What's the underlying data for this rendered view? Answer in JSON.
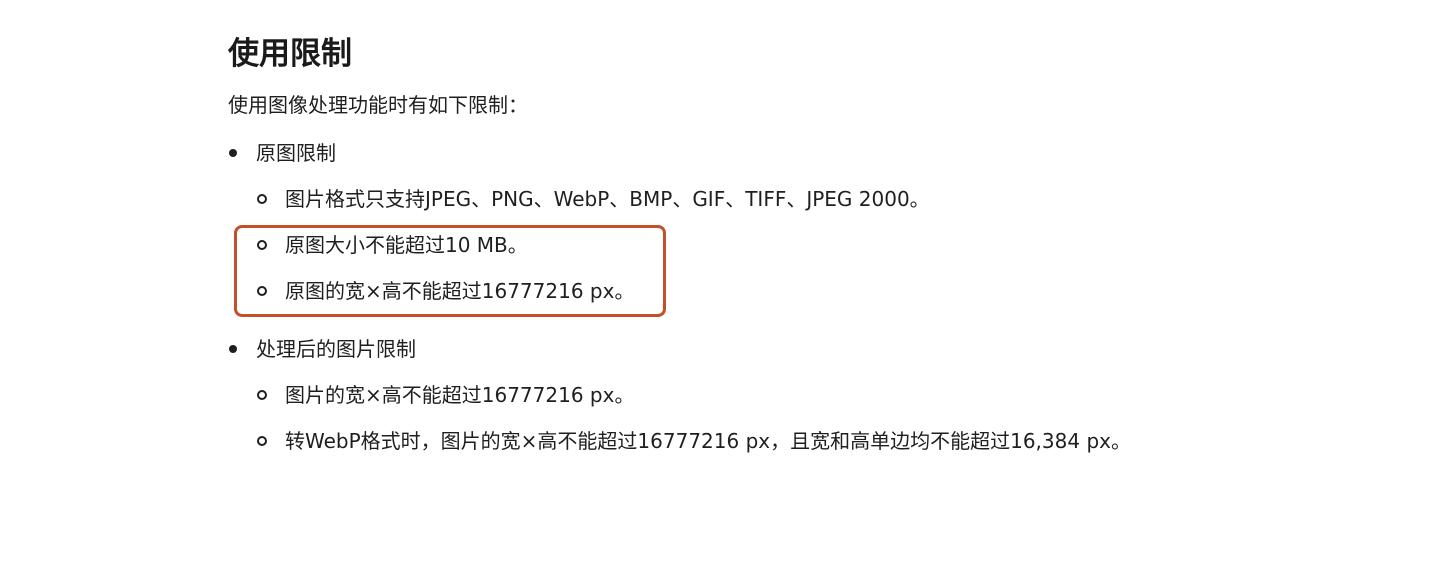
{
  "document": {
    "title": "使用限制",
    "intro": "使用图像处理功能时有如下限制：",
    "sections": [
      {
        "label": "原图限制",
        "items": [
          "图片格式只支持JPEG、PNG、WebP、BMP、GIF、TIFF、JPEG 2000。",
          "原图大小不能超过10 MB。",
          "原图的宽×高不能超过16777216 px。"
        ]
      },
      {
        "label": "处理后的图片限制",
        "items": [
          "图片的宽×高不能超过16777216 px。",
          "转WebP格式时，图片的宽×高不能超过16777216 px，且宽和高单边均不能超过16,384 px。"
        ]
      }
    ]
  },
  "annotation": {
    "highlight_color": "#c4502a"
  }
}
